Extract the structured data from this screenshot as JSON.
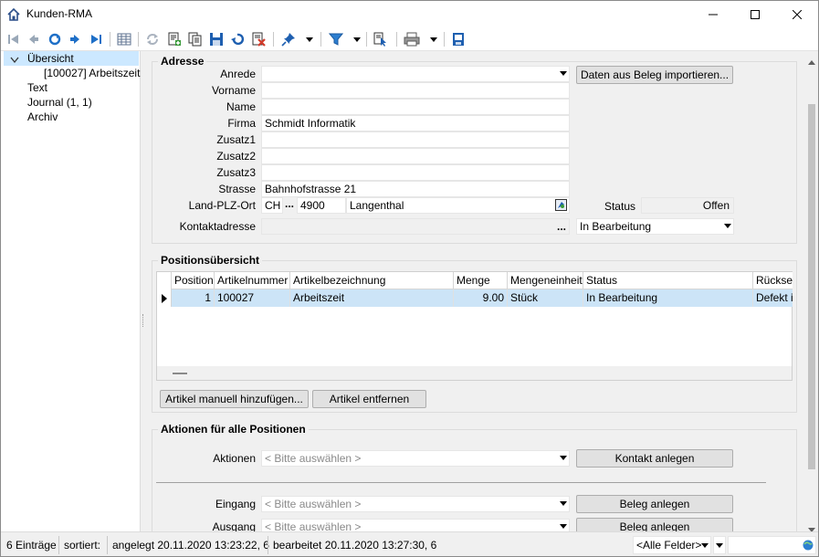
{
  "window": {
    "title": "Kunden-RMA",
    "minimize_label": "—",
    "maximize_label": "☐",
    "close_label": "✕"
  },
  "toolbar": {
    "icons": [
      "first-record-icon",
      "previous-record-icon",
      "refresh-circle-icon",
      "next-record-icon",
      "last-record-icon",
      "table-view-icon",
      "reload-icon",
      "new-document-icon",
      "copy-document-icon",
      "save-icon",
      "undo-icon",
      "delete-icon",
      "pin-icon",
      "filter-icon",
      "document-pointer-icon",
      "print-icon",
      "export-icon"
    ],
    "colors": {
      "blue": "#1e6fc7",
      "green": "#3a9a3a",
      "red": "#d23b2b",
      "gray": "#9aa8b8"
    }
  },
  "tree": {
    "items": [
      {
        "label": "Übersicht",
        "expanded": true,
        "selected": true
      },
      {
        "label": "[100027]  Arbeitszeit"
      },
      {
        "label": "Text"
      },
      {
        "label": "Journal (1, 1)"
      },
      {
        "label": "Archiv"
      }
    ]
  },
  "adresse": {
    "title": "Adresse",
    "anrede_label": "Anrede",
    "anrede_value": "",
    "vorname_label": "Vorname",
    "vorname_value": "",
    "name_label": "Name",
    "name_value": "",
    "firma_label": "Firma",
    "firma_value": "Schmidt Informatik",
    "zusatz1_label": "Zusatz1",
    "zusatz2_label": "Zusatz2",
    "zusatz3_label": "Zusatz3",
    "strasse_label": "Strasse",
    "strasse_value": "Bahnhofstrasse 21",
    "landplzort_label": "Land-PLZ-Ort",
    "land_value": "CH",
    "plz_value": "4900",
    "ort_value": "Langenthal",
    "dots": "...",
    "kontaktadresse_label": "Kontaktadresse",
    "kontaktadresse_value": "",
    "import_button": "Daten aus Beleg importieren...",
    "status_label": "Status",
    "status_value": "Offen",
    "bearbeitung_value": "In Bearbeitung"
  },
  "positionen": {
    "title": "Positionsübersicht",
    "columns": [
      "Position",
      "Artikelnummer",
      "Artikelbezeichnung",
      "Menge",
      "Mengeneinheit",
      "Status",
      "Rücksen"
    ],
    "rows": [
      [
        "1",
        "100027",
        "Arbeitszeit",
        "9.00",
        "Stück",
        "In Bearbeitung",
        "Defekt in"
      ]
    ],
    "add_button": "Artikel manuell hinzufügen...",
    "remove_button": "Artikel entfernen"
  },
  "aktionen": {
    "title": "Aktionen für alle Positionen",
    "aktionen_label": "Aktionen",
    "aktionen_placeholder": "< Bitte auswählen >",
    "kontakt_button": "Kontakt anlegen",
    "eingang_label": "Eingang",
    "eingang_placeholder": "< Bitte auswählen >",
    "eingang_button": "Beleg anlegen",
    "ausgang_label": "Ausgang",
    "ausgang_placeholder": "< Bitte auswählen >",
    "ausgang_button": "Beleg anlegen"
  },
  "statusbar": {
    "count": "6 Einträge",
    "sorted": "sortiert:",
    "created": "angelegt 20.11.2020 13:23:22,  6",
    "edited": "bearbeitet 20.11.2020 13:27:30,  6",
    "field_filter": "<Alle Felder>",
    "search_value": ""
  }
}
